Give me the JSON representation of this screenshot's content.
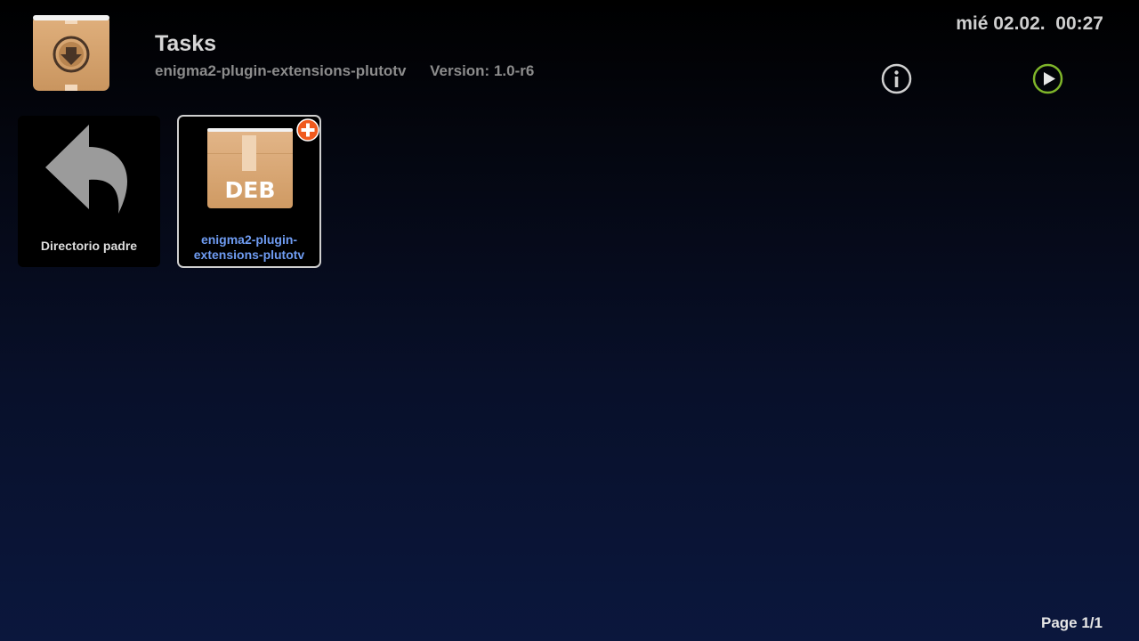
{
  "header": {
    "title": "Tasks",
    "package_name": "enigma2-plugin-extensions-plutotv",
    "version": "Version: 1.0-r6",
    "app_icon": "package-download-icon"
  },
  "clock": {
    "text": "mié 02.02.  00:27"
  },
  "buttons": {
    "info_icon": "info-icon",
    "play_icon": "play-icon",
    "play_color": "#7fb52a"
  },
  "items": [
    {
      "label": "Directorio padre",
      "icon": "back-arrow-icon"
    },
    {
      "label": "enigma2-plugin-extensions-plutotv",
      "icon": "deb-package-icon",
      "icon_text": "DEB",
      "badge": "add-badge-icon",
      "selected": true
    }
  ],
  "colors": {
    "selected_label": "#6f9cf2",
    "badge": "#f05a1e",
    "package": "#d4a16e"
  },
  "footer": {
    "page": "Page 1/1"
  }
}
